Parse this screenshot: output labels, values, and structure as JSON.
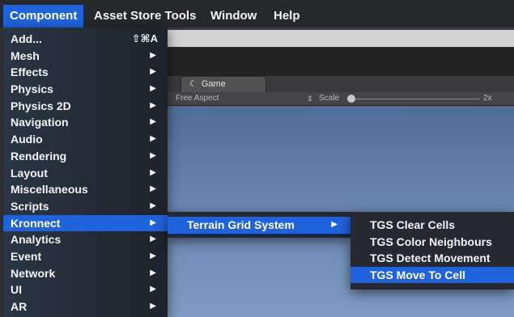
{
  "menubar": {
    "items": [
      {
        "label": "Component",
        "active": true
      },
      {
        "label": "Asset Store Tools",
        "active": false
      },
      {
        "label": "Window",
        "active": false
      },
      {
        "label": "Help",
        "active": false
      }
    ]
  },
  "component_menu": {
    "items": [
      {
        "label": "Add...",
        "shortcut": "⇧⌘A"
      },
      {
        "label": "Mesh",
        "submenu": true
      },
      {
        "label": "Effects",
        "submenu": true
      },
      {
        "label": "Physics",
        "submenu": true
      },
      {
        "label": "Physics 2D",
        "submenu": true
      },
      {
        "label": "Navigation",
        "submenu": true
      },
      {
        "label": "Audio",
        "submenu": true
      },
      {
        "label": "Rendering",
        "submenu": true
      },
      {
        "label": "Layout",
        "submenu": true
      },
      {
        "label": "Miscellaneous",
        "submenu": true
      },
      {
        "label": "Scripts",
        "submenu": true
      },
      {
        "label": "Kronnect",
        "submenu": true,
        "highlighted": true
      },
      {
        "label": "Analytics",
        "submenu": true
      },
      {
        "label": "Event",
        "submenu": true
      },
      {
        "label": "Network",
        "submenu": true
      },
      {
        "label": "UI",
        "submenu": true
      },
      {
        "label": "AR",
        "submenu": true
      }
    ],
    "arrow_glyph": "▶"
  },
  "kronnect_menu": {
    "items": [
      {
        "label": "Terrain Grid System",
        "submenu": true,
        "highlighted": true
      }
    ]
  },
  "tgs_menu": {
    "items": [
      {
        "label": "TGS Clear Cells"
      },
      {
        "label": "TGS Color Neighbours"
      },
      {
        "label": "TGS Detect Movement"
      },
      {
        "label": "TGS Move To Cell",
        "highlighted": true
      }
    ]
  },
  "game_panel": {
    "tab_icon": "unity-game-icon",
    "tab_label": "Game",
    "aspect_label": "Free Aspect",
    "dropdown_glyph": "⇕",
    "scale_label": "Scale",
    "scale_value": "2x"
  },
  "colors": {
    "highlight": "#1f63dc",
    "menu_bg": "#222a34",
    "sky_top": "#4f6d98",
    "sky_bottom": "#7d9bc3"
  }
}
